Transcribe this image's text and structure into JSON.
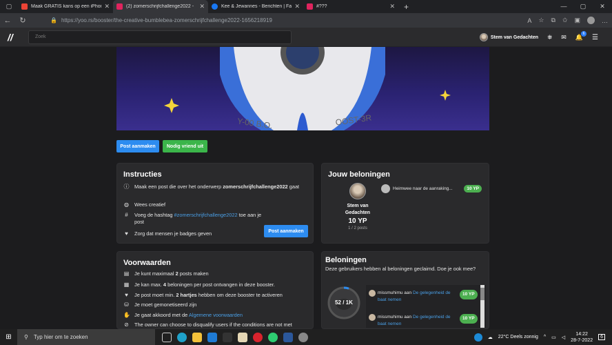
{
  "browser": {
    "tabs": [
      {
        "title": "Maak GRATIS kans op een iPhone",
        "fav_color": "#ea4335"
      },
      {
        "title": "(2) zomerschrijfchallenge2022 - ",
        "fav_color": "#e0245e"
      },
      {
        "title": "Kee & Jewannes - Berichten | Fa",
        "fav_color": "#1877f2"
      },
      {
        "title": "#???",
        "fav_color": "#e0245e"
      }
    ],
    "url": "https://yoo.rs/booster/the-creative-bumblebea-zomerschrijfchallenge2022-1656218919"
  },
  "site": {
    "logo": "//",
    "search_placeholder": "Zoek",
    "user_name": "Stem van Gedachten",
    "notif_count": "6"
  },
  "actions": {
    "post_button": "Post aanmaken",
    "invite_button": "Nodig vriend uit"
  },
  "instructies": {
    "title": "Instructies",
    "items": [
      {
        "pre": "Maak een post die over het onderwerp ",
        "bold": "zomerschrijfchallenge2022",
        "post": " gaat"
      },
      {
        "text": "Wees creatief"
      },
      {
        "pre": "Voeg de hashtag ",
        "link": "#zomerschrijfchallenge2022",
        "post": " toe aan je post"
      },
      {
        "text": "Zorg dat mensen je badges geven"
      }
    ],
    "button": "Post aanmaken"
  },
  "rewards": {
    "title": "Jouw beloningen",
    "name": "Stem van Gedachten",
    "yp": "10 YP",
    "posts": "1 / 2 posts",
    "post_title": "Heimwee naar de aanraking...",
    "post_yp": "10 YP"
  },
  "voorwaarden": {
    "title": "Voorwaarden",
    "items": [
      {
        "pre": "Je kunt maximaal ",
        "bold": "2",
        "post": " posts maken"
      },
      {
        "pre": "Je kan max. ",
        "bold": "4",
        "post": " beloningen per post ontvangen in deze booster."
      },
      {
        "pre": "Je post moet min. ",
        "bold": "2 hartjes",
        "post": " hebben om deze booster te activeren"
      },
      {
        "text": "Je moet gemonetiseerd zijn"
      },
      {
        "pre": "Je gaat akkoord met de ",
        "link": "Algemene voorwaarden",
        "post": ""
      },
      {
        "text": "The owner can choose to disqualify users if the conditions are not met"
      }
    ]
  },
  "beloningen": {
    "title": "Beloningen",
    "desc": "Deze gebruikers hebben al beloningen geclaimd. Doe je ook mee?",
    "progress": "52 / 1K",
    "progress_fraction": 0.052,
    "claims": [
      {
        "user": "missmuhimu",
        "aan": "aan",
        "post": "De gelegenheid de baat nemen",
        "yp": "10 YP"
      },
      {
        "user": "missmuhimu",
        "aan": "aan",
        "post": "De gelegenheid de baat nemen",
        "yp": "10 YP"
      }
    ]
  },
  "taskbar": {
    "search": "Typ hier om te zoeken",
    "weather": "22°C  Deels zonnig",
    "time": "14:22",
    "date": "28-7-2022",
    "notif": "6"
  }
}
